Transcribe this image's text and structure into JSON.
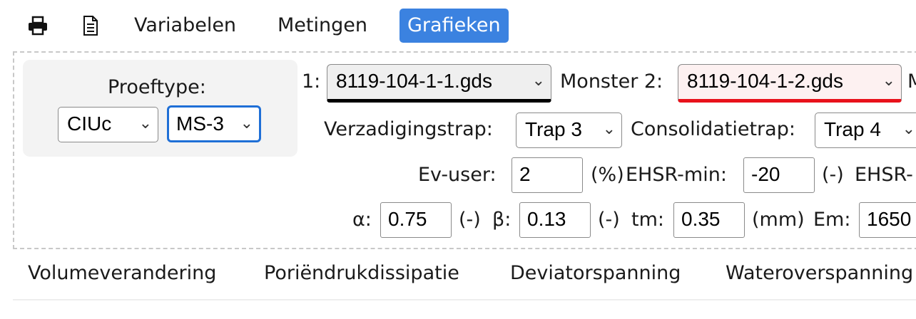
{
  "toolbar": {
    "icons": [
      "printer-icon",
      "document-icon"
    ],
    "menu": [
      "Variabelen",
      "Metingen",
      "Grafieken"
    ],
    "active": "Grafieken"
  },
  "proeftype": {
    "label": "Proeftype:",
    "type_value": "CIUc",
    "sample_value": "MS-3"
  },
  "samples": {
    "s1_label": "1:",
    "s1_value": "8119-104-1-1.gds",
    "s1_color": "#000000",
    "s2_label": "Monster 2:",
    "s2_value": "8119-104-1-2.gds",
    "s2_color": "#e8121b",
    "s3_label_partial": "M"
  },
  "steps": {
    "verz_label": "Verzadigingstrap:",
    "verz_value": "Trap 3",
    "cons_label": "Consolidatietrap:",
    "cons_value": "Trap 4"
  },
  "params1": {
    "ev_label": "Ev-user:",
    "ev_value": "2",
    "ev_unit": "(%)",
    "ehsr_min_label": "EHSR-min:",
    "ehsr_min_value": "-20",
    "ehsr_min_unit": "(-)",
    "ehsr_next_partial": "EHSR-"
  },
  "params2": {
    "alpha_label": "α:",
    "alpha_value": "0.75",
    "alpha_unit": "(-)",
    "beta_label": "β:",
    "beta_value": "0.13",
    "beta_unit": "(-)",
    "tm_label": "tm:",
    "tm_value": "0.35",
    "tm_unit": "(mm)",
    "em_label": "Em:",
    "em_value": "1650"
  },
  "tabs": [
    "Volumeverandering",
    "Poriëndrukdissipatie",
    "Deviatorspanning",
    "Wateroverspanning"
  ],
  "colors": {
    "accent": "#3b82e0",
    "focus": "#1f6fd6"
  }
}
